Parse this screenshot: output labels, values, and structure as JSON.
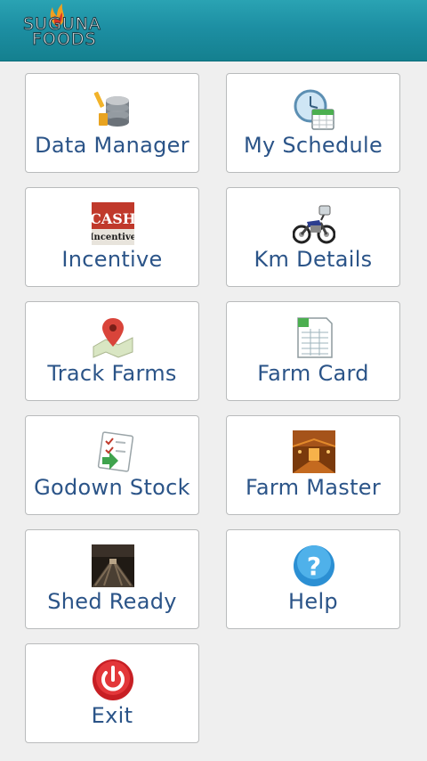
{
  "header": {
    "logo_line1": "SUGUNA",
    "logo_line2": "FOODS"
  },
  "tiles": [
    {
      "label": "Data Manager",
      "icon": "database-icon"
    },
    {
      "label": "My Schedule",
      "icon": "clock-calendar-icon"
    },
    {
      "label": "Incentive",
      "icon": "cash-incentive-icon"
    },
    {
      "label": "Km Details",
      "icon": "motorcycle-icon"
    },
    {
      "label": "Track Farms",
      "icon": "map-pin-icon"
    },
    {
      "label": "Farm Card",
      "icon": "spreadsheet-icon"
    },
    {
      "label": "Godown Stock",
      "icon": "checklist-icon"
    },
    {
      "label": "Farm Master",
      "icon": "farm-shed-photo-icon"
    },
    {
      "label": "Shed Ready",
      "icon": "shed-interior-photo-icon"
    },
    {
      "label": "Help",
      "icon": "help-icon"
    },
    {
      "label": "Exit",
      "icon": "power-exit-icon"
    }
  ],
  "incentive_icon_text": {
    "line1": "CASH",
    "line2": "Incentive"
  },
  "colors": {
    "header": "#1d8fa3",
    "label": "#2b5488",
    "tile_border": "#b9bbbc",
    "background": "#efefef"
  }
}
